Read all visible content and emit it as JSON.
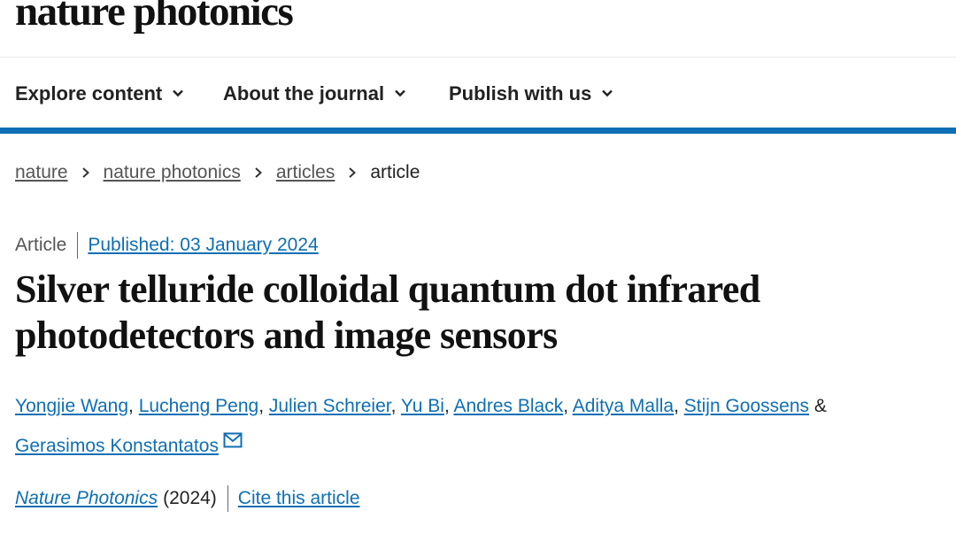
{
  "site": {
    "logo": "nature photonics"
  },
  "nav": {
    "items": [
      {
        "label": "Explore content"
      },
      {
        "label": "About the journal"
      },
      {
        "label": "Publish with us"
      }
    ]
  },
  "breadcrumb": {
    "items": [
      "nature",
      "nature photonics",
      "articles"
    ],
    "current": "article"
  },
  "article": {
    "type": "Article",
    "published": "Published: 03 January 2024",
    "title": "Silver telluride colloidal quantum dot infrared photodetectors and image sensors",
    "authors": [
      "Yongjie Wang",
      "Lucheng Peng",
      "Julien Schreier",
      "Yu Bi",
      "Andres Black",
      "Aditya Malla",
      "Stijn Goossens",
      "Gerasimos Konstantatos"
    ],
    "author_conjunction": "&",
    "journal": "Nature Photonics",
    "year": "(2024)",
    "cite_label": "Cite this article"
  },
  "colors": {
    "link": "#0f6fb4",
    "rule": "#0f6fb4"
  },
  "icons": {
    "nav_chevron": "chevron-down-icon",
    "breadcrumb_sep": "chevron-right-icon",
    "corresponding": "mail-icon"
  }
}
